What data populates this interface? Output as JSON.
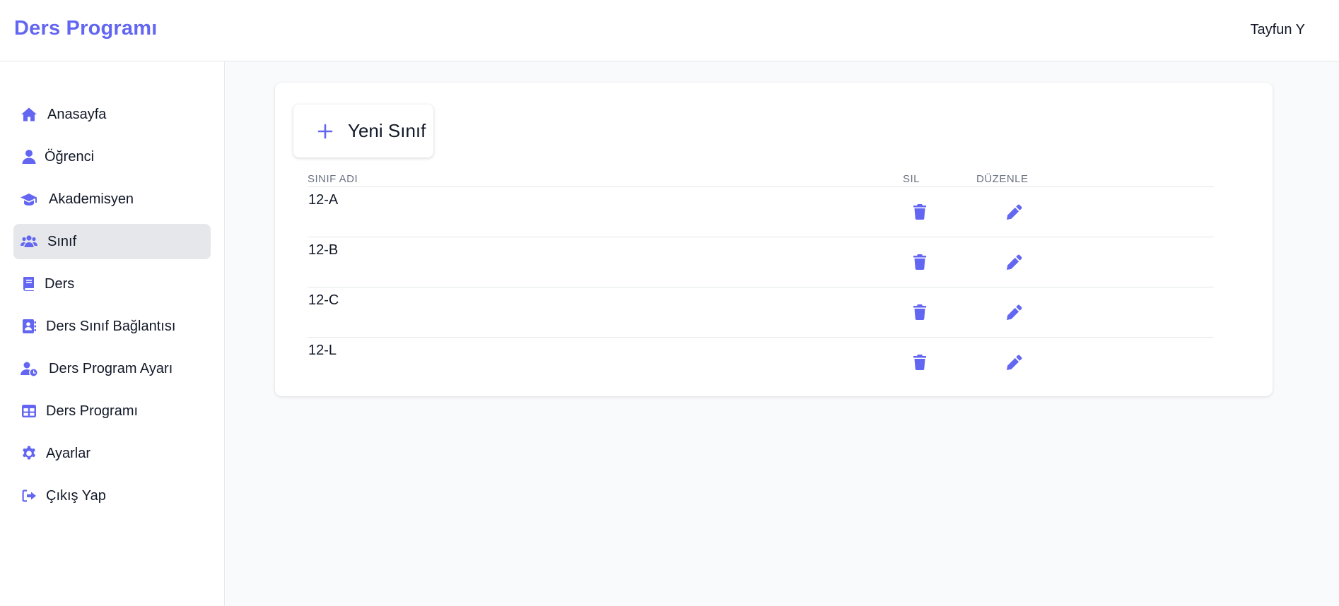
{
  "header": {
    "title": "Ders Programı",
    "user": "Tayfun Y"
  },
  "sidebar": {
    "items": [
      {
        "label": "Anasayfa",
        "icon": "home-icon"
      },
      {
        "label": "Öğrenci",
        "icon": "user-icon"
      },
      {
        "label": "Akademisyen",
        "icon": "graduation-cap-icon"
      },
      {
        "label": "Sınıf",
        "icon": "users-icon",
        "active": true
      },
      {
        "label": "Ders",
        "icon": "book-icon"
      },
      {
        "label": "Ders Sınıf Bağlantısı",
        "icon": "address-book-icon"
      },
      {
        "label": "Ders Program Ayarı",
        "icon": "user-clock-icon"
      },
      {
        "label": "Ders Programı",
        "icon": "table-icon"
      },
      {
        "label": "Ayarlar",
        "icon": "gear-icon"
      },
      {
        "label": "Çıkış Yap",
        "icon": "sign-out-icon"
      }
    ]
  },
  "main": {
    "new_button": "Yeni Sınıf",
    "table": {
      "headers": {
        "name": "SINIF ADI",
        "delete": "SIL",
        "edit": "DÜZENLE"
      },
      "rows": [
        "12-A",
        "12-B",
        "12-C",
        "12-L"
      ]
    }
  },
  "colors": {
    "accent": "#6366f1",
    "active_bg": "#e5e7eb",
    "main_bg": "#f9fafb",
    "text": "#111827",
    "muted": "#6b7280"
  }
}
